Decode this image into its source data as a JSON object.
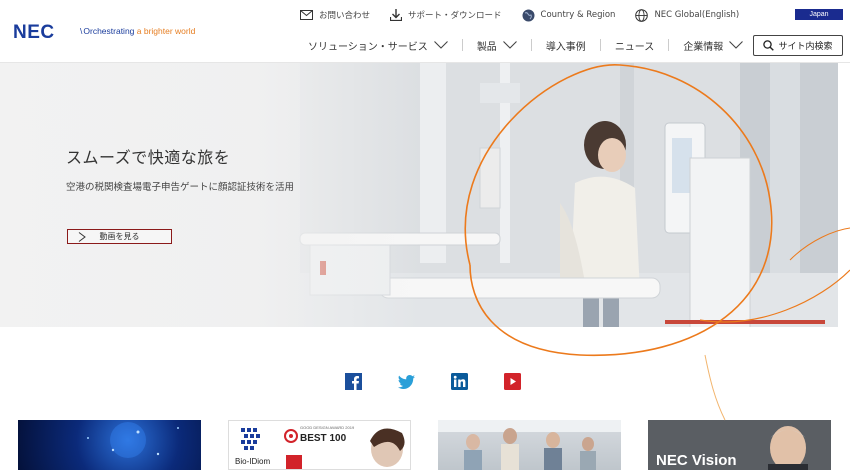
{
  "header": {
    "logo": "NEC",
    "tagline_main": "Orchestrating",
    "tagline_accent": " a brighter world",
    "utility": [
      {
        "label": "お問い合わせ",
        "icon": "mail-icon"
      },
      {
        "label": "サポート・ダウンロード",
        "icon": "download-icon"
      },
      {
        "label": "Country & Region",
        "icon": "globe-dark-icon"
      },
      {
        "label": "NEC Global(English)",
        "icon": "globe-outline-icon"
      }
    ],
    "language_button": "Japan",
    "nav": [
      {
        "label": "ソリューション・サービス",
        "dropdown": true
      },
      {
        "label": "製品",
        "dropdown": true
      },
      {
        "label": "導入事例",
        "dropdown": false
      },
      {
        "label": "ニュース",
        "dropdown": false
      },
      {
        "label": "企業情報",
        "dropdown": true
      }
    ],
    "search_label": "サイト内検索"
  },
  "hero": {
    "title": "スムーズで快適な旅を",
    "description": "空港の税関検査場電子申告ゲートに顔認証技術を活用",
    "video_button": "動画を見る"
  },
  "social": [
    {
      "name": "facebook",
      "color": "#1b4f9c"
    },
    {
      "name": "twitter",
      "color": "#2a9fd8"
    },
    {
      "name": "linkedin",
      "color": "#0a5a9a"
    },
    {
      "name": "youtube",
      "color": "#d2232a"
    }
  ],
  "cards": {
    "bio_label": "Bio-IDiom",
    "gda_label": "GOOD DESIGN AWARD 2019",
    "best_label": "BEST 100",
    "vision_label": "NEC Vision"
  },
  "colors": {
    "brand_blue": "#1a3c9c",
    "accent_orange": "#e67e22",
    "button_border": "#8b1a1a"
  }
}
